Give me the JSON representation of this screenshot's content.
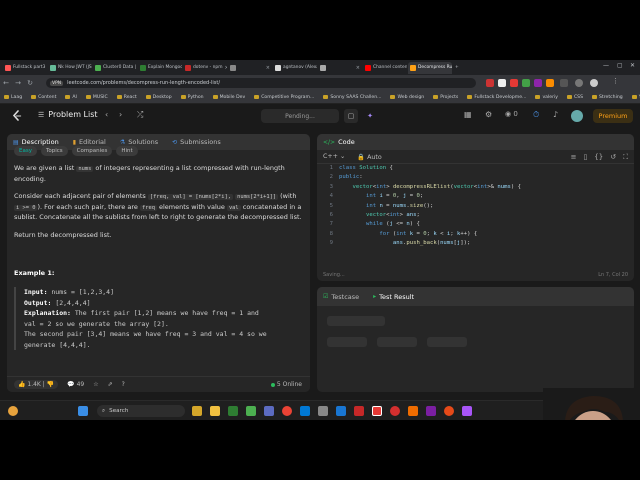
{
  "browser": {
    "tabs": [
      {
        "label": "Fullstack part3 | prope...",
        "color": "#f55",
        "active": false
      },
      {
        "label": "Nk How JWT (JSON Web T",
        "color": "#6b9",
        "active": false
      },
      {
        "label": "Cluster0 Data | Cloud: M",
        "color": "#4caf50",
        "active": false
      },
      {
        "label": "Explain Mongoose Opti...",
        "color": "#2e7d32",
        "active": false
      },
      {
        "label": "dotenv - npm",
        "color": "#c62828",
        "active": false
      },
      {
        "label": "",
        "color": "#888",
        "active": false
      },
      {
        "label": "agntanov (Alexander Pe",
        "color": "#ddd",
        "active": false
      },
      {
        "label": "",
        "color": "#aaa",
        "active": false
      },
      {
        "label": "Channel content - YouTu",
        "color": "#f00",
        "active": false
      },
      {
        "label": "Decompress Run-Length",
        "color": "#ffa116",
        "active": true
      }
    ],
    "url": "leetcode.com/problems/decompress-run-length-encoded-list/",
    "vpn_label": "VPN",
    "bookmarks": [
      "Laag",
      "Content",
      "AI",
      "MUSIC",
      "React",
      "Desktop",
      "Python",
      "Mobile Dev",
      "Competitive Program...",
      "Sonny SAAS Challen...",
      "Web design",
      "Projects",
      "Fullstack Developme...",
      "valeriy",
      "CSS",
      "Stretching",
      "YouTube"
    ]
  },
  "header": {
    "problem_list_label": "Problem List",
    "pending_label": "Pending...",
    "coins": "0",
    "premium_label": "Premium"
  },
  "left_panel": {
    "tabs": [
      "Description",
      "Editorial",
      "Solutions",
      "Submissions"
    ],
    "chips": [
      "Easy",
      "Topics",
      "Companies",
      "Hint"
    ],
    "p1_a": "We are given a list ",
    "p1_code": "nums",
    "p1_b": " of integers representing a list compressed with run-length encoding.",
    "p2_a": "Consider each adjacent pair of elements ",
    "p2_c1": "[freq, val] = [nums[2*i],",
    "p2_c2": "nums[2*i+1]]",
    "p2_b": " (with ",
    "p2_c3": "i >= 0",
    "p2_c": "). For each such pair, there are ",
    "p2_c4": "freq",
    "p2_d": " elements with value ",
    "p2_c5": "val",
    "p2_e": " concatenated in a sublist. Concatenate all the sublists from left to right to generate the decompressed list.",
    "p3": "Return the decompressed list.",
    "example_title": "Example 1:",
    "input_label": "Input:",
    "input_value": " nums = [1,2,3,4]",
    "output_label": "Output:",
    "output_value": " [2,4,4,4]",
    "explanation_label": "Explanation:",
    "explanation_lines": [
      " The first pair [1,2] means we have freq = 1 and",
      "val = 2 so we generate the array [2].",
      "The second pair [3,4] means we have freq = 3 and val = 4 so we",
      "generate [4,4,4]."
    ],
    "likes": "1.4K",
    "comments": "49",
    "online": "5 Online"
  },
  "code_panel": {
    "title": "Code",
    "language": "C++",
    "mode": "Auto",
    "status": "Saving...",
    "cursor": "Ln 7, Col 20",
    "lines": [
      {
        "n": "1",
        "html": "<span class=\"kw\">class</span> <span class=\"ty\">Solution</span> {"
      },
      {
        "n": "2",
        "html": "<span class=\"kw\">public</span>:"
      },
      {
        "n": "3",
        "html": "    <span class=\"ty\">vector</span>&lt;<span class=\"kw\">int</span>&gt; <span class=\"fn\">decompressRLElist</span>(<span class=\"ty\">vector</span>&lt;<span class=\"kw\">int</span>&gt;&amp; <span class=\"var\">nums</span>) {"
      },
      {
        "n": "4",
        "html": "        <span class=\"kw\">int</span> <span class=\"var\">i</span> = <span class=\"num\">0</span>, <span class=\"var\">j</span> = <span class=\"num\">0</span>;"
      },
      {
        "n": "5",
        "html": "        <span class=\"kw\">int</span> <span class=\"var\">n</span> = <span class=\"var\">nums</span>.<span class=\"fn\">size</span>();"
      },
      {
        "n": "6",
        "html": "        <span class=\"ty\">vector</span>&lt;<span class=\"kw\">int</span>&gt; <span class=\"var\">ans</span>;"
      },
      {
        "n": "7",
        "html": "        <span class=\"kw\">while</span> (<span class=\"var\">j</span> &lt;= <span class=\"var\">n</span>) {"
      },
      {
        "n": "8",
        "html": "            <span class=\"kw\">for</span> (<span class=\"kw\">int</span> <span class=\"var\">k</span> = <span class=\"num\">0</span>; <span class=\"var\">k</span> &lt; <span class=\"var\">i</span>; <span class=\"var\">k</span>++) {"
      },
      {
        "n": "9",
        "html": "                <span class=\"var\">ans</span>.<span class=\"fn\">push_back</span>(<span class=\"var\">nums</span>[<span class=\"var\">j</span>]);"
      }
    ]
  },
  "test_panel": {
    "tabs": [
      "Testcase",
      "Test Result"
    ]
  },
  "taskbar": {
    "search_label": "Search",
    "time": "2:59 PM",
    "date": "..."
  }
}
